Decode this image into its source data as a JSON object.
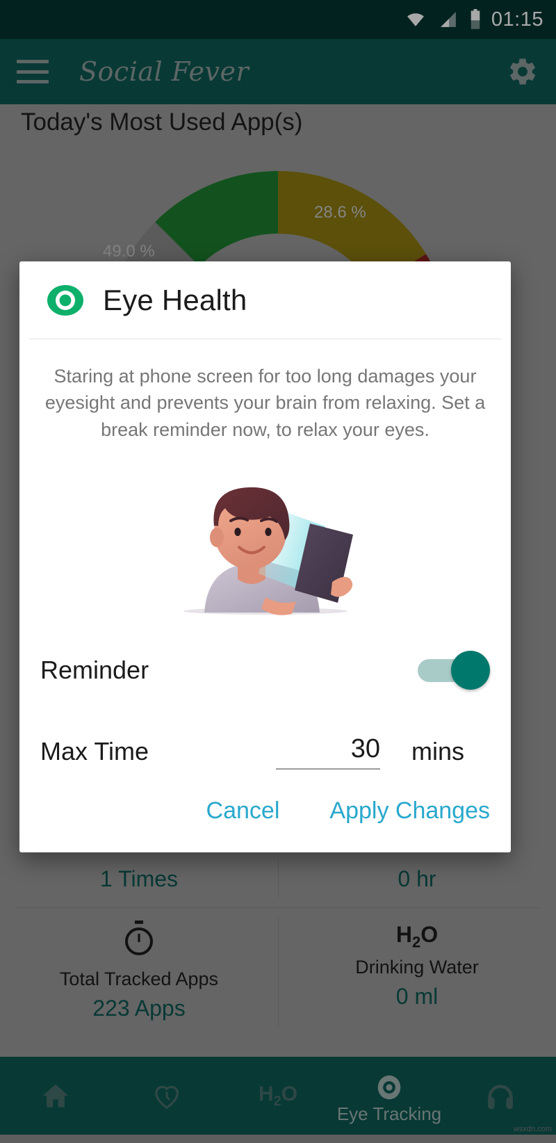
{
  "statusbar": {
    "time": "01:15",
    "icons": [
      "wifi-icon",
      "signal-icon",
      "battery-icon"
    ]
  },
  "appbar": {
    "menu_icon": "hamburger-menu-icon",
    "title": "Social Fever",
    "settings_icon": "gear-icon"
  },
  "content": {
    "section_title": "Today's Most Used App(s)"
  },
  "chart_data": {
    "type": "pie",
    "title": "Today's Most Used App(s)",
    "labels": [
      "49.0 %",
      "28.6 %",
      ""
    ],
    "values": [
      49.0,
      28.6,
      9.0
    ],
    "colors": [
      "#1d7d2e",
      "#8c7a10",
      "#8e1f1f"
    ],
    "legend": "none",
    "grid": false
  },
  "stats": [
    {
      "icon": "",
      "name": "",
      "value": "1 Times"
    },
    {
      "icon": "",
      "name": "",
      "value": "0 hr"
    },
    {
      "icon": "stopwatch-icon",
      "name": "Total Tracked Apps",
      "value": "223 Apps"
    },
    {
      "icon": "H2O",
      "name": "Drinking Water",
      "value": "0 ml"
    }
  ],
  "dialog": {
    "icon": "eye-icon",
    "title": "Eye Health",
    "description": "Staring at phone screen for too long damages your eyesight and prevents your brain from relaxing. Set a break reminder now, to relax your eyes.",
    "illustration": "boy-reading-tablet-illustration",
    "reminder": {
      "label": "Reminder",
      "state": "on"
    },
    "max_time": {
      "label": "Max Time",
      "value": "30",
      "placeholder": "30",
      "unit": "mins"
    },
    "cancel_label": "Cancel",
    "apply_label": "Apply Changes"
  },
  "bottomnav": {
    "items": [
      {
        "icon": "home-icon",
        "label": ""
      },
      {
        "icon": "heart-clock-icon",
        "label": ""
      },
      {
        "icon": "water-h2o-icon",
        "label": ""
      },
      {
        "icon": "eye-icon",
        "label": "Eye Tracking"
      },
      {
        "icon": "headphones-icon",
        "label": ""
      }
    ]
  },
  "watermark": {
    "text": "wsxdn.com"
  },
  "colors": {
    "status_bar": "#043430",
    "app_bar": "#0d5751",
    "accent_link": "#28a8cc",
    "toggle_on": "#00796c",
    "toggle_track": "#a9cbc7",
    "stat_value": "#0d5751"
  }
}
